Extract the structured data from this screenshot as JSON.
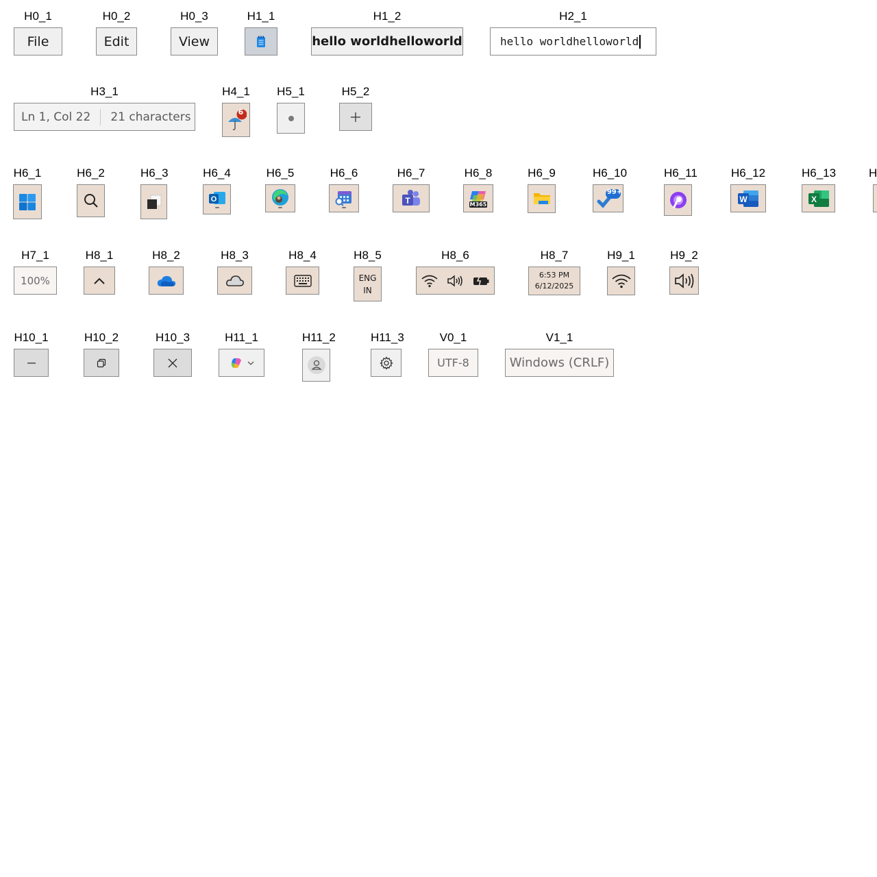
{
  "rows": [
    [
      {
        "label": "H0_1",
        "text": "File"
      },
      {
        "label": "H0_2",
        "text": "Edit"
      },
      {
        "label": "H0_3",
        "text": "View"
      },
      {
        "label": "H1_1",
        "icon": "notepad-icon"
      },
      {
        "label": "H1_2",
        "text": "hello worldhelloworld"
      },
      {
        "label": "H2_1",
        "text": "hello worldhelloworld"
      }
    ],
    [
      {
        "label": "H3_1",
        "status_position": "Ln 1, Col 22",
        "status_count": "21 characters"
      },
      {
        "label": "H4_1",
        "icon": "weather-umbrella-icon",
        "badge": "6"
      },
      {
        "label": "H5_1",
        "icon": "dot-icon"
      },
      {
        "label": "H5_2",
        "icon": "plus-icon"
      }
    ],
    [
      {
        "label": "H6_1",
        "icon": "windows-start-icon"
      },
      {
        "label": "H6_2",
        "icon": "search-icon"
      },
      {
        "label": "H6_3",
        "icon": "task-view-icon"
      },
      {
        "label": "H6_4",
        "icon": "outlook-icon"
      },
      {
        "label": "H6_5",
        "icon": "edge-icon"
      },
      {
        "label": "H6_6",
        "icon": "calendar-search-icon"
      },
      {
        "label": "H6_7",
        "icon": "teams-icon"
      },
      {
        "label": "H6_8",
        "icon": "m365-icon",
        "badge": "M365"
      },
      {
        "label": "H6_9",
        "icon": "file-explorer-icon"
      },
      {
        "label": "H6_10",
        "icon": "todo-icon",
        "badge": "99+"
      },
      {
        "label": "H6_11",
        "icon": "copilot-app-icon"
      },
      {
        "label": "H6_12",
        "icon": "word-icon"
      },
      {
        "label": "H6_13",
        "icon": "excel-icon"
      },
      {
        "label": "H"
      }
    ],
    [
      {
        "label": "H7_1",
        "text": "100%"
      },
      {
        "label": "H8_1",
        "icon": "chevron-up-icon"
      },
      {
        "label": "H8_2",
        "icon": "onedrive-cloud-icon"
      },
      {
        "label": "H8_3",
        "icon": "cloud-icon"
      },
      {
        "label": "H8_4",
        "icon": "keyboard-icon"
      },
      {
        "label": "H8_5",
        "line1": "ENG",
        "line2": "IN"
      },
      {
        "label": "H8_6",
        "icon": "wifi-volume-battery-icon"
      },
      {
        "label": "H8_7",
        "time": "6:53 PM",
        "date": "6/12/2025"
      },
      {
        "label": "H9_1",
        "icon": "wifi-icon"
      },
      {
        "label": "H9_2",
        "icon": "volume-icon"
      }
    ],
    [
      {
        "label": "H10_1",
        "icon": "minimize-icon"
      },
      {
        "label": "H10_2",
        "icon": "restore-icon"
      },
      {
        "label": "H10_3",
        "icon": "close-icon"
      },
      {
        "label": "H11_1",
        "icon": "copilot-dropdown-icon"
      },
      {
        "label": "H11_2",
        "icon": "account-icon"
      },
      {
        "label": "H11_3",
        "icon": "gear-icon"
      },
      {
        "label": "V0_1",
        "text": "UTF-8"
      },
      {
        "label": "V1_1",
        "text": "Windows (CRLF)"
      }
    ]
  ],
  "colors": {
    "windows_blue": "#0f6cbd",
    "teams_purple": "#5b5fc7",
    "word_blue": "#185abd",
    "excel_green": "#107c41",
    "badge_red": "#c42b1c",
    "folder_yellow": "#f4b400"
  }
}
